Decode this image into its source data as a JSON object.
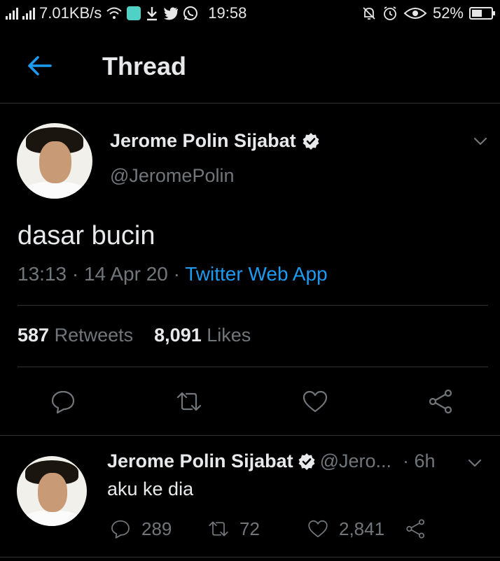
{
  "status_bar": {
    "network_speed": "7.01KB/s",
    "time": "19:58",
    "battery": "52%",
    "battery_level": 0.52
  },
  "header": {
    "title": "Thread"
  },
  "tweet": {
    "author_name": "Jerome Polin Sijabat",
    "author_handle": "@JeromePolin",
    "text": "dasar bucin",
    "time": "13:13",
    "date": "14 Apr 20",
    "source": "Twitter Web App",
    "retweets_count": "587",
    "retweets_label": "Retweets",
    "likes_count": "8,091",
    "likes_label": "Likes"
  },
  "reply": {
    "author_name": "Jerome Polin Sijabat",
    "author_handle": "@Jero...",
    "time": "· 6h",
    "text": "aku ke dia",
    "replies": "289",
    "retweets": "72",
    "likes": "2,841"
  },
  "colors": {
    "accent": "#1d9bf0",
    "muted": "#71767b",
    "background": "#000000"
  },
  "icons": [
    "back-arrow-icon",
    "verified-badge-icon",
    "chevron-down-icon",
    "reply-icon",
    "retweet-icon",
    "like-icon",
    "share-icon"
  ]
}
